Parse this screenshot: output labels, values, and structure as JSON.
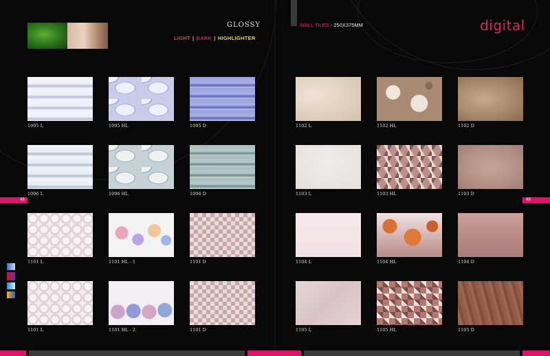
{
  "header": {
    "title": "GLOSSY",
    "variants": {
      "light": "LIGHT",
      "sep": "|",
      "dark": "DARK",
      "highlighter": "HIGHLIGHTER"
    },
    "wall_label": "WALL TILES",
    "size_label": "- 250X375MM",
    "brand": "digital"
  },
  "page_numbers": {
    "left": "48",
    "right": "49"
  },
  "colors": {
    "accent": "#e0116a",
    "background": "#080808",
    "light": "#e24a2c",
    "dark": "#d21e6d",
    "highlighter": "#ffd21a"
  },
  "tiles": [
    {
      "code": "1095 L"
    },
    {
      "code": "1095 HL"
    },
    {
      "code": "1095 D"
    },
    {
      "code": "1096 L"
    },
    {
      "code": "1096 HL"
    },
    {
      "code": "1096 D"
    },
    {
      "code": "1101 L"
    },
    {
      "code": "1101 HL - 1"
    },
    {
      "code": "1101 D"
    },
    {
      "code": "1101 L"
    },
    {
      "code": "1101 HL - 2"
    },
    {
      "code": "1101 D"
    },
    {
      "code": "1102 L"
    },
    {
      "code": "1102 HL"
    },
    {
      "code": "1102 D"
    },
    {
      "code": "1103 L"
    },
    {
      "code": "1103 HL"
    },
    {
      "code": "1103 D"
    },
    {
      "code": "1104 L"
    },
    {
      "code": "1104 HL"
    },
    {
      "code": "1104 D"
    },
    {
      "code": "1105 L"
    },
    {
      "code": "1105 HL"
    },
    {
      "code": "1105 D"
    }
  ]
}
